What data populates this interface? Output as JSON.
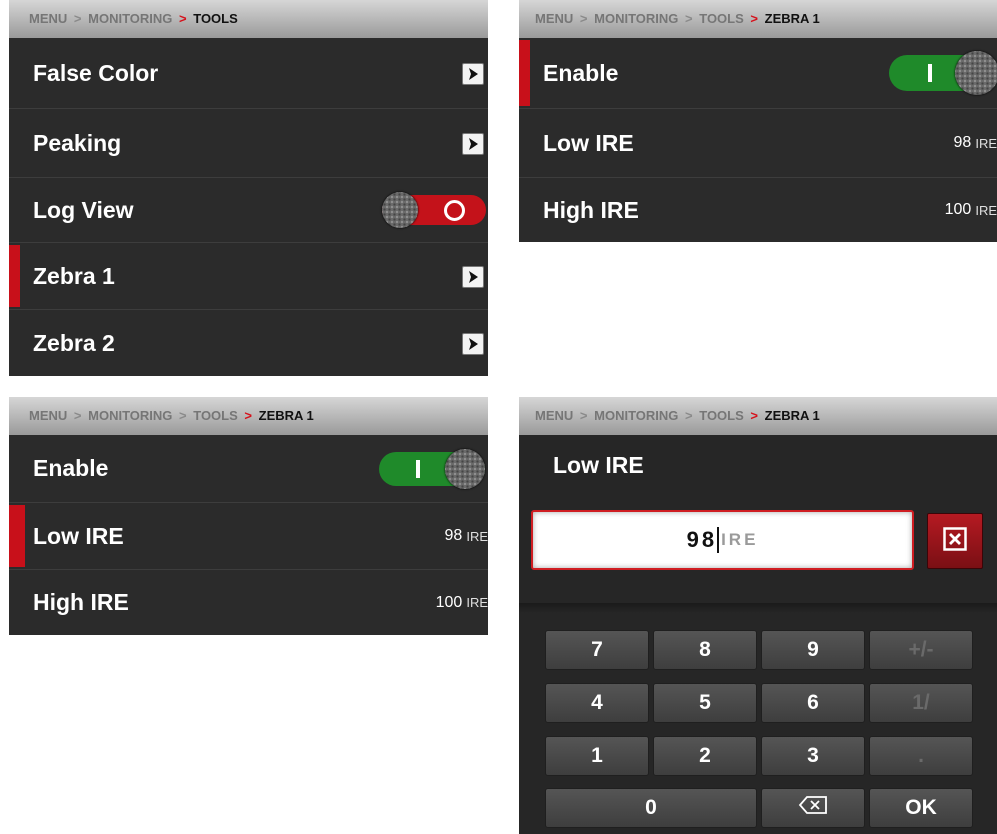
{
  "panel_tools": {
    "breadcrumb": {
      "menu": "MENU",
      "sep1": ">",
      "monitoring": "MONITORING",
      "sep2": ">",
      "current": "TOOLS"
    },
    "items": [
      {
        "label": "False Color",
        "control": "arrow"
      },
      {
        "label": "Peaking",
        "control": "arrow"
      },
      {
        "label": "Log View",
        "control": "toggle",
        "state": "off"
      },
      {
        "label": "Zebra 1",
        "control": "arrow",
        "selected": true
      },
      {
        "label": "Zebra 2",
        "control": "arrow"
      }
    ]
  },
  "panel_zebra_a": {
    "breadcrumb": {
      "menu": "MENU",
      "sep1": ">",
      "monitoring": "MONITORING",
      "sep2": ">",
      "tools": "TOOLS",
      "sep3": ">",
      "current": "ZEBRA 1"
    },
    "enable_label": "Enable",
    "enable_state": "on",
    "enable_selected": true,
    "low_label": "Low IRE",
    "low_value": "98",
    "low_unit": "IRE",
    "high_label": "High IRE",
    "high_value": "100",
    "high_unit": "IRE"
  },
  "panel_zebra_b": {
    "breadcrumb": {
      "menu": "MENU",
      "sep1": ">",
      "monitoring": "MONITORING",
      "sep2": ">",
      "tools": "TOOLS",
      "sep3": ">",
      "current": "ZEBRA 1"
    },
    "enable_label": "Enable",
    "enable_state": "on",
    "low_label": "Low IRE",
    "low_selected": true,
    "low_value": "98",
    "low_unit": "IRE",
    "high_label": "High IRE",
    "high_value": "100",
    "high_unit": "IRE"
  },
  "panel_keypad": {
    "breadcrumb": {
      "menu": "MENU",
      "sep1": ">",
      "monitoring": "MONITORING",
      "sep2": ">",
      "tools": "TOOLS",
      "sep3": ">",
      "current": "ZEBRA 1"
    },
    "title": "Low IRE",
    "entry_value": "98",
    "entry_unit": "IRE",
    "keys": {
      "k7": "7",
      "k8": "8",
      "k9": "9",
      "plusminus": "+/-",
      "k4": "4",
      "k5": "5",
      "k6": "6",
      "reciprocal": "1/",
      "k1": "1",
      "k2": "2",
      "k3": "3",
      "decimal": ".",
      "k0": "0",
      "ok": "OK"
    }
  },
  "icons": {
    "arrow": "chevron-right-icon",
    "clear": "clear-x-icon",
    "backspace": "backspace-icon"
  },
  "colors": {
    "accent_red": "#c8101a",
    "toggle_on": "#1f8a2a",
    "toggle_off": "#c4121a",
    "panel_bg": "#2b2b2b"
  }
}
